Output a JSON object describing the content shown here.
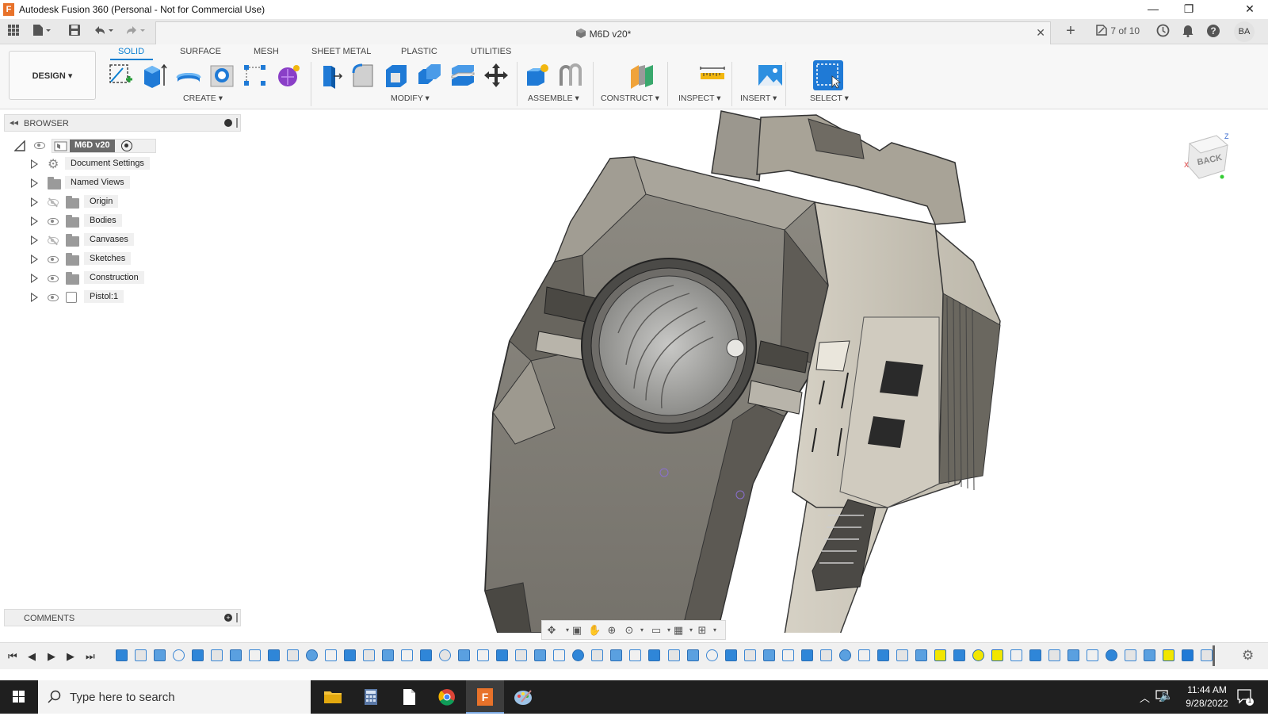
{
  "window": {
    "title": "Autodesk Fusion 360 (Personal - Not for Commercial Use)",
    "logo_letter": "F",
    "minimize_glyph": "—",
    "restore_glyph": "❐",
    "close_glyph": "✕"
  },
  "tabbar": {
    "document_title": "M6D v20*",
    "close_glyph": "✕",
    "new_tab_glyph": "+",
    "job_status": "7 of 10",
    "user_initials": "BA"
  },
  "ribbon": {
    "workspace_label": "DESIGN ▾",
    "tabs": [
      "SOLID",
      "SURFACE",
      "MESH",
      "SHEET METAL",
      "PLASTIC",
      "UTILITIES"
    ],
    "active_tab": "SOLID",
    "groups": [
      "CREATE ▾",
      "MODIFY ▾",
      "ASSEMBLE ▾",
      "CONSTRUCT ▾",
      "INSPECT ▾",
      "INSERT ▾",
      "SELECT ▾"
    ]
  },
  "browser": {
    "title": "BROWSER",
    "root_label": "M6D v20",
    "items": [
      {
        "label": "Document Settings",
        "icon": "gear-icon",
        "visible": null
      },
      {
        "label": "Named Views",
        "icon": "folder-icon",
        "visible": null
      },
      {
        "label": "Origin",
        "icon": "folder-icon",
        "visible": false
      },
      {
        "label": "Bodies",
        "icon": "folder-icon",
        "visible": true
      },
      {
        "label": "Canvases",
        "icon": "folder-icon",
        "visible": false
      },
      {
        "label": "Sketches",
        "icon": "folder-icon",
        "visible": true
      },
      {
        "label": "Construction",
        "icon": "folder-icon",
        "visible": true
      },
      {
        "label": "Pistol:1",
        "icon": "component-icon",
        "visible": true
      }
    ]
  },
  "comments": {
    "title": "COMMENTS"
  },
  "viewcube": {
    "face_label": "BACK",
    "axis_x": "X",
    "axis_z": "Z"
  },
  "timeline": {
    "controls": [
      "⏮",
      "◀",
      "▶",
      "▶",
      "⏭"
    ],
    "feature_count": 58
  },
  "taskbar": {
    "search_placeholder": "Type here to search",
    "time": "11:44 AM",
    "date": "9/28/2022",
    "notification_count": "1"
  },
  "colors": {
    "accent": "#0a7fd1",
    "ribbon_bg": "#f7f7f7",
    "model_dark": "#6e6b64",
    "model_light": "#c9c4b8",
    "taskbar": "#1f1f1f"
  }
}
